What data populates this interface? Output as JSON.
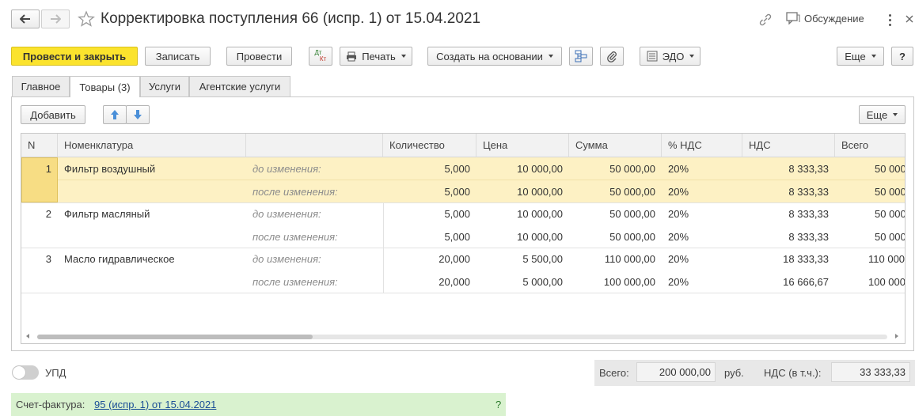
{
  "title": "Корректировка поступления 66 (испр. 1) от 15.04.2021",
  "header": {
    "discussion_label": "Обсуждение"
  },
  "toolbar": {
    "post_close": "Провести и закрыть",
    "save": "Записать",
    "post": "Провести",
    "dtkt_top": "Дт",
    "dtkt_bottom": "Кт",
    "print": "Печать",
    "create_based": "Создать на основании",
    "edo": "ЭДО",
    "more": "Еще",
    "help": "?"
  },
  "tabs": [
    "Главное",
    "Товары (3)",
    "Услуги",
    "Агентские услуги"
  ],
  "table_toolbar": {
    "add": "Добавить",
    "more": "Еще"
  },
  "table": {
    "columns": [
      "N",
      "Номенклатура",
      "",
      "Количество",
      "Цена",
      "Сумма",
      "% НДС",
      "НДС",
      "Всего"
    ],
    "rows": [
      {
        "n": "1",
        "name": "Фильтр воздушный",
        "before": {
          "label": "до изменения:",
          "qty": "5,000",
          "price": "10 000,00",
          "sum": "50 000,00",
          "vat_rate": "20%",
          "vat": "8 333,33",
          "total": "50 000"
        },
        "after": {
          "label": "после изменения:",
          "qty": "5,000",
          "price": "10 000,00",
          "sum": "50 000,00",
          "vat_rate": "20%",
          "vat": "8 333,33",
          "total": "50 000"
        }
      },
      {
        "n": "2",
        "name": "Фильтр масляный",
        "before": {
          "label": "до изменения:",
          "qty": "5,000",
          "price": "10 000,00",
          "sum": "50 000,00",
          "vat_rate": "20%",
          "vat": "8 333,33",
          "total": "50 000"
        },
        "after": {
          "label": "после изменения:",
          "qty": "5,000",
          "price": "10 000,00",
          "sum": "50 000,00",
          "vat_rate": "20%",
          "vat": "8 333,33",
          "total": "50 000"
        }
      },
      {
        "n": "3",
        "name": "Масло гидравлическое",
        "before": {
          "label": "до изменения:",
          "qty": "20,000",
          "price": "5 500,00",
          "sum": "110 000,00",
          "vat_rate": "20%",
          "vat": "18 333,33",
          "total": "110 000"
        },
        "after": {
          "label": "после изменения:",
          "qty": "20,000",
          "price": "5 000,00",
          "sum": "100 000,00",
          "vat_rate": "20%",
          "vat": "16 666,67",
          "total": "100 000"
        }
      }
    ]
  },
  "footer": {
    "upd_label": "УПД",
    "total_label": "Всего:",
    "total_value": "200 000,00",
    "currency": "руб.",
    "vat_label": "НДС (в т.ч.):",
    "vat_value": "33 333,33",
    "invoice_label": "Счет-фактура:",
    "invoice_link": "95 (испр. 1) от 15.04.2021",
    "invoice_help": "?"
  },
  "colors": {
    "primary_button": "#fbe32d",
    "selected_row": "#fdf1c4",
    "invoice_bar": "#d9f2cf",
    "link": "#1a4e96"
  }
}
